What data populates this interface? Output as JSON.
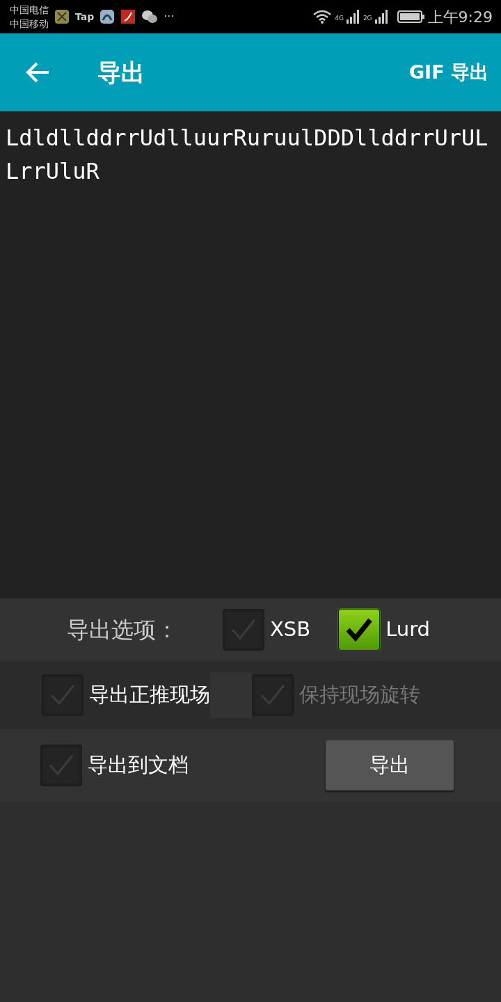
{
  "status_bar": {
    "carriers": [
      "中国电信",
      "中国移动"
    ],
    "app_label": "Tap",
    "more": "···",
    "network_1": "4G",
    "network_2": "2G",
    "time": "上午9:29"
  },
  "toolbar": {
    "title": "导出",
    "action": "GIF 导出"
  },
  "export_text": "LdldllddrrUdlluurRuruulDDDllddrrUrULLrrUluR",
  "options": {
    "label": "导出选项：",
    "formats": [
      {
        "label": "XSB",
        "checked": false
      },
      {
        "label": "Lurd",
        "checked": true
      }
    ],
    "settings": [
      {
        "label": "导出正推现场",
        "checked": false,
        "disabled": false
      },
      {
        "label": "保持现场旋转",
        "checked": false,
        "disabled": true
      }
    ],
    "to_file": {
      "label": "导出到文档",
      "checked": false
    },
    "button": "导出"
  }
}
